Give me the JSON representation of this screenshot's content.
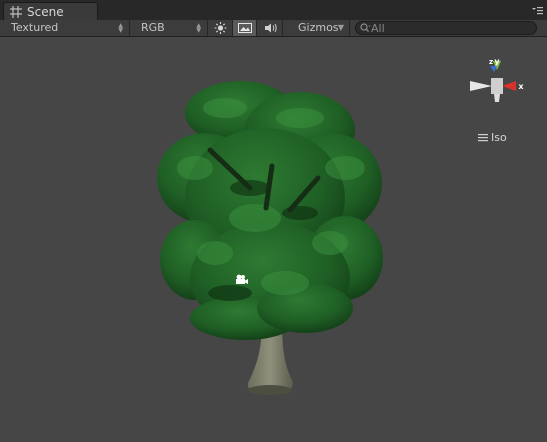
{
  "tab": {
    "label": "Scene"
  },
  "toolbar": {
    "render_mode": "Textured",
    "channel": "RGB",
    "gizmos_label": "Gizmos",
    "search_placeholder": "All",
    "buttons": [
      "sun-icon",
      "image-icon",
      "audio-icon"
    ],
    "image_toggle_active": true
  },
  "scene_gizmo": {
    "axes": [
      "y",
      "x",
      "z"
    ],
    "projection_label": "Iso",
    "colors": {
      "x": "#d8332a",
      "y": "#7fc13a",
      "z": "#3a6ed8"
    }
  },
  "viewport": {
    "background": "#464646",
    "icons": [
      "tree-object",
      "camera-icon"
    ]
  }
}
